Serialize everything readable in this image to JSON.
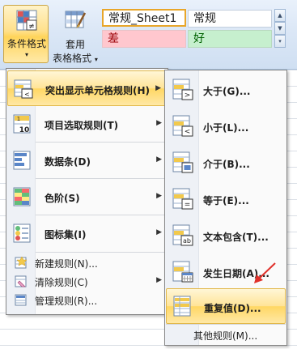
{
  "ribbon": {
    "conditional_format": {
      "label": "条件格式",
      "arrow": "▾",
      "icon": "conditional-format-icon"
    },
    "format_table": {
      "label_line1": "套用",
      "label_line2": "表格格式",
      "arrow": "▾",
      "icon": "format-as-table-icon"
    },
    "cell_styles": {
      "normal_sheet1": "常规_Sheet1",
      "normal": "常规",
      "bad": "差",
      "good": "好"
    },
    "gallery_scroll": {
      "up": "▲",
      "down": "▼",
      "more": "▾"
    }
  },
  "menu": {
    "items": [
      {
        "label": "突出显示单元格规则(H)",
        "submenu_arrow": "▶",
        "icon": "highlight-cells-rules-icon"
      },
      {
        "label": "项目选取规则(T)",
        "submenu_arrow": "▶",
        "icon": "top-bottom-rules-icon"
      },
      {
        "label": "数据条(D)",
        "submenu_arrow": "▶",
        "icon": "data-bars-icon"
      },
      {
        "label": "色阶(S)",
        "submenu_arrow": "▶",
        "icon": "color-scales-icon"
      },
      {
        "label": "图标集(I)",
        "submenu_arrow": "▶",
        "icon": "icon-sets-icon"
      },
      {
        "label": "新建规则(N)...",
        "icon": "new-rule-icon"
      },
      {
        "label": "清除规则(C)",
        "submenu_arrow": "▶",
        "icon": "clear-rules-icon"
      },
      {
        "label": "管理规则(R)...",
        "icon": "manage-rules-icon"
      }
    ]
  },
  "submenu": {
    "items": [
      {
        "label": "大于(G)...",
        "icon": "greater-than-icon"
      },
      {
        "label": "小于(L)...",
        "icon": "less-than-icon"
      },
      {
        "label": "介于(B)...",
        "icon": "between-icon"
      },
      {
        "label": "等于(E)...",
        "icon": "equal-to-icon"
      },
      {
        "label": "文本包含(T)...",
        "icon": "text-contains-icon"
      },
      {
        "label": "发生日期(A)...",
        "icon": "date-occurring-icon"
      },
      {
        "label": "重复值(D)...",
        "icon": "duplicate-values-icon"
      },
      {
        "label": "其他规则(M)..."
      }
    ]
  },
  "colors": {
    "highlight": "#ffd763",
    "highlight_border": "#e2b84a",
    "bad_fill": "#ffc7ce",
    "bad_text": "#9c0006",
    "good_fill": "#c6efce",
    "good_text": "#006100",
    "annotation_arrow": "#e0302a"
  }
}
